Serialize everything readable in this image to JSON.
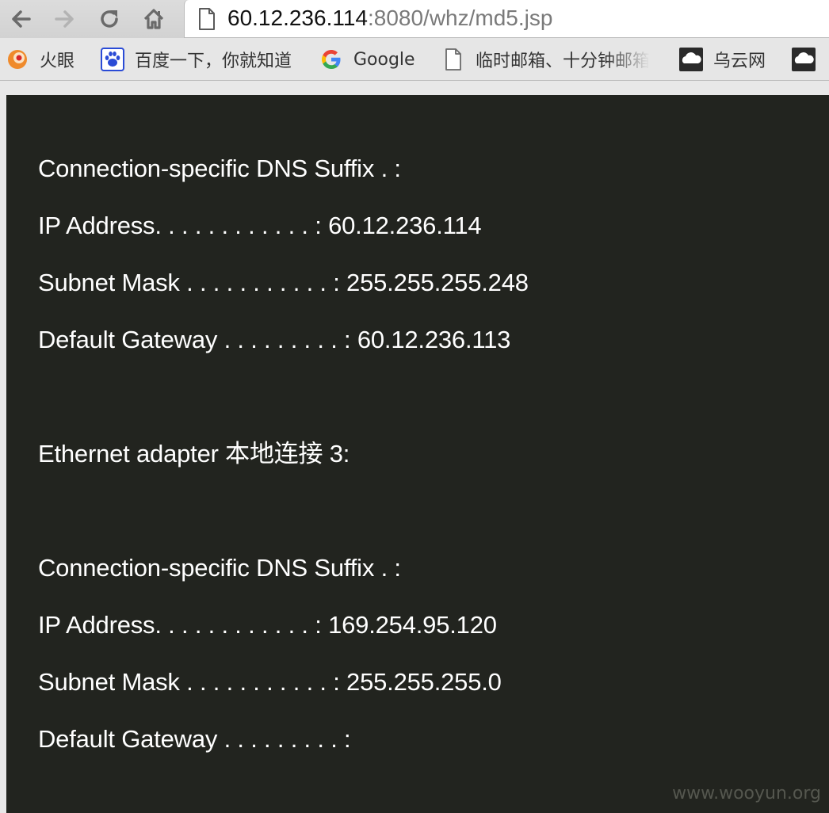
{
  "browser": {
    "url_host": "60.12.236.114",
    "url_rest": ":8080/whz/md5.jsp"
  },
  "bookmarks": [
    {
      "label": "火眼",
      "icon": "huoyan-icon"
    },
    {
      "label": "百度一下，你就知道",
      "icon": "baidu-paw-icon"
    },
    {
      "label": "Google",
      "icon": "google-icon"
    },
    {
      "label": "临时邮箱、十分钟邮箱",
      "icon": "document-icon"
    },
    {
      "label": "乌云网",
      "icon": "wooyun-cloud-icon"
    }
  ],
  "content": {
    "lines": [
      "Connection-specific DNS Suffix . :",
      "IP Address. . . . . . . . . . . . : 60.12.236.114",
      "Subnet Mask . . . . . . . . . . . : 255.255.255.248",
      "Default Gateway . . . . . . . . . : 60.12.236.113",
      "Ethernet adapter 本地连接 3:",
      "Connection-specific DNS Suffix . :",
      "IP Address. . . . . . . . . . . . : 169.254.95.120",
      "Subnet Mask . . . . . . . . . . . : 255.255.255.0",
      "Default Gateway . . . . . . . . . :"
    ],
    "watermark": "www.wooyun.org"
  },
  "colors": {
    "content_bg": "#22241f",
    "text": "#ffffff",
    "toolbar": "#d6d6d6"
  }
}
